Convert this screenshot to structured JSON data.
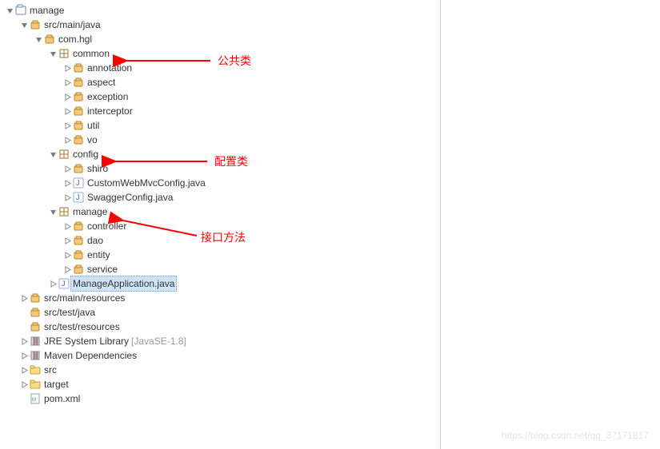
{
  "annotations": {
    "common": "公共类",
    "config": "配置类",
    "manage": "接口方法"
  },
  "watermark": "https://blog.csdn.net/qq_37171817",
  "tree": [
    {
      "d": 0,
      "t": "v",
      "i": "prj",
      "l": "manage"
    },
    {
      "d": 1,
      "t": "v",
      "i": "pkg",
      "l": "src/main/java"
    },
    {
      "d": 2,
      "t": "v",
      "i": "pkg",
      "l": "com.hgl"
    },
    {
      "d": 3,
      "t": "v",
      "i": "pkgsq",
      "l": "common"
    },
    {
      "d": 4,
      "t": ">",
      "i": "pkg",
      "l": "annotation"
    },
    {
      "d": 4,
      "t": ">",
      "i": "pkg",
      "l": "aspect"
    },
    {
      "d": 4,
      "t": ">",
      "i": "pkg",
      "l": "exception"
    },
    {
      "d": 4,
      "t": ">",
      "i": "pkg",
      "l": "interceptor"
    },
    {
      "d": 4,
      "t": ">",
      "i": "pkg",
      "l": "util"
    },
    {
      "d": 4,
      "t": ">",
      "i": "pkg",
      "l": "vo"
    },
    {
      "d": 3,
      "t": "v",
      "i": "pkgsq",
      "l": "config"
    },
    {
      "d": 4,
      "t": ">",
      "i": "pkg",
      "l": "shiro"
    },
    {
      "d": 4,
      "t": ">",
      "i": "java",
      "l": "CustomWebMvcConfig.java"
    },
    {
      "d": 4,
      "t": ">",
      "i": "java",
      "l": "SwaggerConfig.java"
    },
    {
      "d": 3,
      "t": "v",
      "i": "pkgsq",
      "l": "manage"
    },
    {
      "d": 4,
      "t": ">",
      "i": "pkg",
      "l": "controller"
    },
    {
      "d": 4,
      "t": ">",
      "i": "pkg",
      "l": "dao"
    },
    {
      "d": 4,
      "t": ">",
      "i": "pkg",
      "l": "entity"
    },
    {
      "d": 4,
      "t": ">",
      "i": "pkg",
      "l": "service"
    },
    {
      "d": 3,
      "t": ">",
      "i": "java",
      "l": "ManageApplication.java",
      "sel": true
    },
    {
      "d": 1,
      "t": ">",
      "i": "pkg",
      "l": "src/main/resources"
    },
    {
      "d": 1,
      "t": "",
      "i": "pkg",
      "l": "src/test/java"
    },
    {
      "d": 1,
      "t": "",
      "i": "pkg",
      "l": "src/test/resources"
    },
    {
      "d": 1,
      "t": ">",
      "i": "lib",
      "l": "JRE System Library",
      "h": "[JavaSE-1.8]"
    },
    {
      "d": 1,
      "t": ">",
      "i": "lib",
      "l": "Maven Dependencies"
    },
    {
      "d": 1,
      "t": ">",
      "i": "fld",
      "l": "src"
    },
    {
      "d": 1,
      "t": ">",
      "i": "fld",
      "l": "target"
    },
    {
      "d": 1,
      "t": "",
      "i": "xml",
      "l": "pom.xml"
    }
  ]
}
